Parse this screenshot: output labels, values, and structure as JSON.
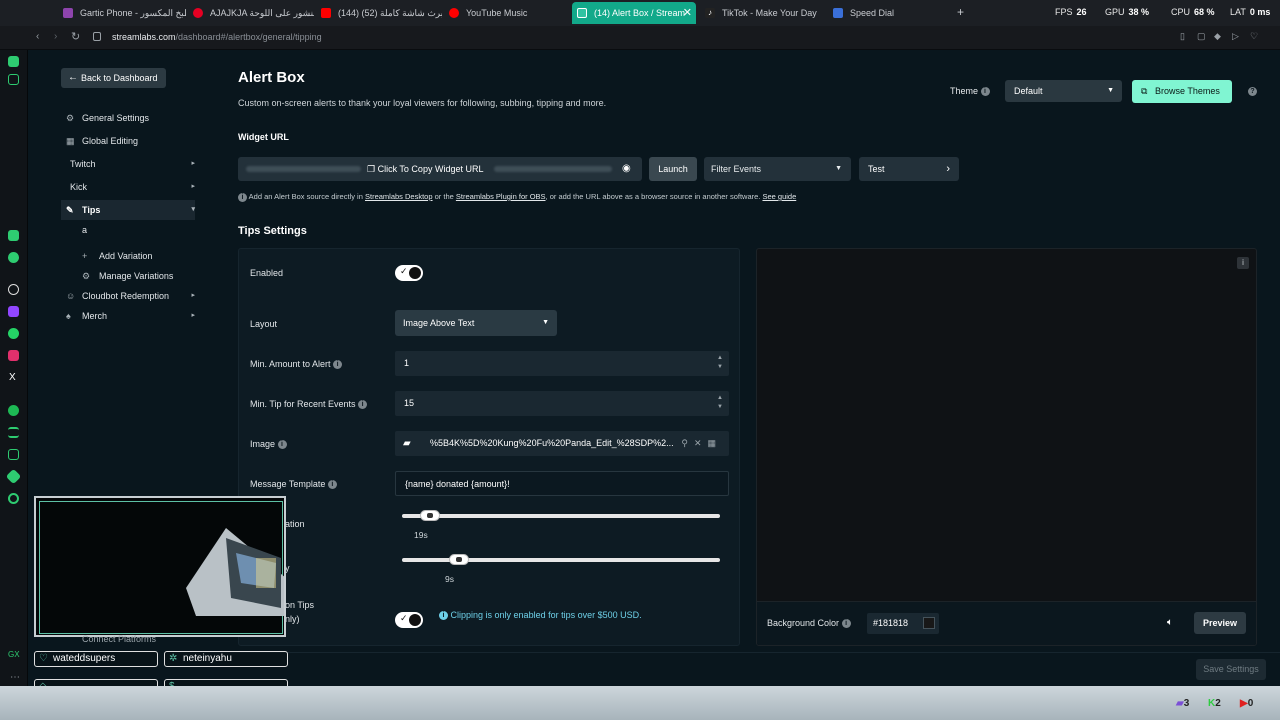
{
  "browser": {
    "tabs": [
      {
        "label": "Gartic Phone - مطبخ المكسور",
        "color": "#8e44ad"
      },
      {
        "label": "AJAJKJA منشور على اللوحة",
        "color": "#e60023"
      },
      {
        "label": "(144) البرث شاشة كاملة (52)",
        "color": "#ff0000"
      },
      {
        "label": "YouTube Music",
        "color": "#ff0000"
      },
      {
        "label": "(14) Alert Box / Stream",
        "color": "#31c3a2"
      },
      {
        "label": "TikTok - Make Your Day",
        "color": "#222222"
      },
      {
        "label": "Speed Dial",
        "color": "#3a6fd8"
      }
    ],
    "stats": {
      "fps_label": "FPS",
      "fps_value": "26",
      "gpu_label": "GPU",
      "gpu_value": "38 %",
      "cpu_label": "CPU",
      "cpu_value": "68 %",
      "lat_label": "LAT",
      "lat_value": "0 ms"
    },
    "url_host": "streamlabs.com",
    "url_path": "/dashboard#/alertbox/general/tipping"
  },
  "nav": {
    "back_label": "Back to Dashboard",
    "items": [
      {
        "label": "General Settings",
        "icon": "gear-icon"
      },
      {
        "label": "Global Editing",
        "icon": "grid-icon"
      },
      {
        "label": "Twitch",
        "icon": ""
      },
      {
        "label": "Kick",
        "icon": ""
      },
      {
        "label": "Tips",
        "icon": "tip-icon"
      },
      {
        "label": "a",
        "icon": ""
      },
      {
        "label": "Add Variation",
        "icon": "plus-icon"
      },
      {
        "label": "Manage Variations",
        "icon": "gear-icon"
      },
      {
        "label": "Cloudbot Redemption",
        "icon": "robot-icon"
      },
      {
        "label": "Merch",
        "icon": "shirt-icon"
      }
    ],
    "connect_label": "Connect Platforms"
  },
  "header": {
    "title": "Alert Box",
    "subtitle": "Custom on-screen alerts to thank your loyal viewers for following, subbing, tipping and more.",
    "theme_label": "Theme",
    "theme_value": "Default",
    "browse_label": "Browse Themes"
  },
  "widget": {
    "url_label": "Widget URL",
    "copy_label": "Click To Copy Widget URL",
    "launch_label": "Launch",
    "filter_label": "Filter Events",
    "test_label": "Test",
    "note_pre": "Add an Alert Box source directly in",
    "note_link1": "Streamlabs Desktop",
    "note_mid": "or the",
    "note_link2": "Streamlabs Plugin for OBS",
    "note_post": ", or add the URL above as a browser source in another software.",
    "note_link3": "See guide"
  },
  "tips": {
    "section_title": "Tips Settings",
    "enabled_label": "Enabled",
    "layout_label": "Layout",
    "layout_value": "Image Above Text",
    "min_amount_label": "Min. Amount to Alert",
    "min_amount_value": "1",
    "min_recent_label": "Min. Tip for Recent Events",
    "min_recent_value": "15",
    "image_label": "Image",
    "image_value": "%5B4K%5D%20Kung%20Fu%20Panda_Edit_%28SDP%2...",
    "template_label": "Message Template",
    "template_value": "{name} donated {amount}!",
    "duration_label": "ation",
    "duration_value": "19s",
    "duration_fraction": 0.06,
    "delay_label": "y",
    "delay_value": "9s",
    "delay_fraction": 0.15,
    "clip_label_1": "on Tips",
    "clip_label_2": "nly)",
    "clip_note": "Clipping is only enabled for tips over $500 USD."
  },
  "preview": {
    "bg_label": "Background Color",
    "bg_value": "#181818",
    "preview_label": "Preview"
  },
  "footer": {
    "save_label": "Save Settings"
  },
  "overlay": {
    "chat_user_1": "wateddsupers",
    "chat_user_2": "neteinyahu"
  },
  "taskbar": {
    "count_1": "3",
    "count_2": "2",
    "count_3": "0"
  }
}
